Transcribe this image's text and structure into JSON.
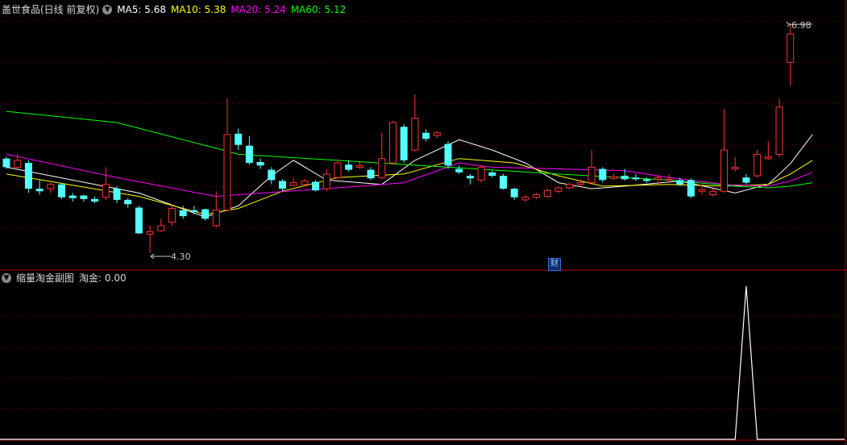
{
  "main_panel": {
    "title": "盖世食品(日线 前复权)",
    "ma": [
      {
        "label": "MA5: 5.68",
        "color": "#ffffff"
      },
      {
        "label": "MA10: 5.38",
        "color": "#ffff00"
      },
      {
        "label": "MA20: 5.24",
        "color": "#ff00ff"
      },
      {
        "label": "MA60: 5.12",
        "color": "#00ff00"
      }
    ],
    "high_label": "6.98",
    "low_label": "4.30",
    "event_marker": "财"
  },
  "sub_panel": {
    "title": "缩量淘金副图",
    "value_label": "淘金: 0.00"
  },
  "colors": {
    "up": "#ff3232",
    "down": "#54ffff",
    "grid": "#8b0000",
    "divider": "#b00000"
  },
  "chart_data": [
    {
      "type": "candlestick",
      "candles": [
        {
          "o": 5.4,
          "c": 5.3,
          "h": 5.42,
          "l": 5.28
        },
        {
          "o": 5.3,
          "c": 5.38,
          "h": 5.45,
          "l": 5.28
        },
        {
          "o": 5.35,
          "c": 5.05,
          "h": 5.38,
          "l": 5.0
        },
        {
          "o": 5.05,
          "c": 5.02,
          "h": 5.15,
          "l": 4.98
        },
        {
          "o": 5.05,
          "c": 5.1,
          "h": 5.12,
          "l": 5.0
        },
        {
          "o": 5.1,
          "c": 4.95,
          "h": 5.12,
          "l": 4.93
        },
        {
          "o": 4.97,
          "c": 4.94,
          "h": 5.0,
          "l": 4.9
        },
        {
          "o": 4.97,
          "c": 4.93,
          "h": 4.98,
          "l": 4.9
        },
        {
          "o": 4.93,
          "c": 4.9,
          "h": 4.96,
          "l": 4.88
        },
        {
          "o": 4.95,
          "c": 5.1,
          "h": 5.3,
          "l": 4.92
        },
        {
          "o": 5.05,
          "c": 4.92,
          "h": 5.08,
          "l": 4.88
        },
        {
          "o": 4.92,
          "c": 4.87,
          "h": 4.94,
          "l": 4.83
        },
        {
          "o": 4.83,
          "c": 4.53,
          "h": 4.85,
          "l": 4.52
        },
        {
          "o": 4.52,
          "c": 4.55,
          "h": 4.62,
          "l": 4.3
        },
        {
          "o": 4.56,
          "c": 4.62,
          "h": 4.7,
          "l": 4.55
        },
        {
          "o": 4.66,
          "c": 4.82,
          "h": 4.86,
          "l": 4.62
        },
        {
          "o": 4.8,
          "c": 4.73,
          "h": 4.85,
          "l": 4.7
        },
        {
          "o": 4.8,
          "c": 4.78,
          "h": 4.85,
          "l": 4.75
        },
        {
          "o": 4.81,
          "c": 4.7,
          "h": 4.82,
          "l": 4.68
        },
        {
          "o": 4.62,
          "c": 4.8,
          "h": 5.02,
          "l": 4.6
        },
        {
          "o": 4.8,
          "c": 5.68,
          "h": 6.1,
          "l": 4.8
        },
        {
          "o": 5.69,
          "c": 5.56,
          "h": 5.75,
          "l": 5.5
        },
        {
          "o": 5.55,
          "c": 5.35,
          "h": 5.66,
          "l": 5.33
        },
        {
          "o": 5.36,
          "c": 5.32,
          "h": 5.4,
          "l": 5.28
        },
        {
          "o": 5.27,
          "c": 5.15,
          "h": 5.3,
          "l": 5.1
        },
        {
          "o": 5.14,
          "c": 5.05,
          "h": 5.16,
          "l": 5.02
        },
        {
          "o": 5.09,
          "c": 5.12,
          "h": 5.18,
          "l": 5.08
        },
        {
          "o": 5.1,
          "c": 5.14,
          "h": 5.16,
          "l": 5.08
        },
        {
          "o": 5.13,
          "c": 5.03,
          "h": 5.15,
          "l": 5.02
        },
        {
          "o": 5.05,
          "c": 5.22,
          "h": 5.28,
          "l": 5.02
        },
        {
          "o": 5.18,
          "c": 5.35,
          "h": 5.37,
          "l": 5.16
        },
        {
          "o": 5.33,
          "c": 5.27,
          "h": 5.38,
          "l": 5.25
        },
        {
          "o": 5.3,
          "c": 5.32,
          "h": 5.36,
          "l": 5.28
        },
        {
          "o": 5.27,
          "c": 5.17,
          "h": 5.3,
          "l": 5.15
        },
        {
          "o": 5.18,
          "c": 5.4,
          "h": 5.7,
          "l": 5.16
        },
        {
          "o": 5.35,
          "c": 5.82,
          "h": 5.84,
          "l": 5.33
        },
        {
          "o": 5.77,
          "c": 5.38,
          "h": 5.8,
          "l": 5.35
        },
        {
          "o": 5.5,
          "c": 5.87,
          "h": 6.15,
          "l": 5.48
        },
        {
          "o": 5.7,
          "c": 5.63,
          "h": 5.74,
          "l": 5.6
        },
        {
          "o": 5.67,
          "c": 5.7,
          "h": 5.72,
          "l": 5.64
        },
        {
          "o": 5.57,
          "c": 5.32,
          "h": 5.6,
          "l": 5.28
        },
        {
          "o": 5.28,
          "c": 5.24,
          "h": 5.32,
          "l": 5.22
        },
        {
          "o": 5.2,
          "c": 5.17,
          "h": 5.22,
          "l": 5.1
        },
        {
          "o": 5.15,
          "c": 5.3,
          "h": 5.32,
          "l": 5.12
        },
        {
          "o": 5.24,
          "c": 5.2,
          "h": 5.26,
          "l": 5.18
        },
        {
          "o": 5.2,
          "c": 5.05,
          "h": 5.22,
          "l": 5.04
        },
        {
          "o": 5.05,
          "c": 4.95,
          "h": 5.06,
          "l": 4.92
        },
        {
          "o": 4.92,
          "c": 4.95,
          "h": 4.98,
          "l": 4.9
        },
        {
          "o": 4.95,
          "c": 4.98,
          "h": 5.0,
          "l": 4.93
        },
        {
          "o": 4.96,
          "c": 5.03,
          "h": 5.05,
          "l": 4.94
        },
        {
          "o": 5.02,
          "c": 5.06,
          "h": 5.08,
          "l": 5.0
        },
        {
          "o": 5.06,
          "c": 5.1,
          "h": 5.12,
          "l": 5.04
        },
        {
          "o": 5.1,
          "c": 5.12,
          "h": 5.16,
          "l": 5.08
        },
        {
          "o": 5.12,
          "c": 5.3,
          "h": 5.5,
          "l": 5.1
        },
        {
          "o": 5.28,
          "c": 5.15,
          "h": 5.3,
          "l": 5.12
        },
        {
          "o": 5.17,
          "c": 5.19,
          "h": 5.22,
          "l": 5.15
        },
        {
          "o": 5.2,
          "c": 5.16,
          "h": 5.28,
          "l": 5.14
        },
        {
          "o": 5.18,
          "c": 5.16,
          "h": 5.22,
          "l": 5.14
        },
        {
          "o": 5.16,
          "c": 5.14,
          "h": 5.18,
          "l": 5.12
        },
        {
          "o": 5.16,
          "c": 5.18,
          "h": 5.2,
          "l": 5.1
        },
        {
          "o": 5.15,
          "c": 5.16,
          "h": 5.22,
          "l": 5.14
        },
        {
          "o": 5.15,
          "c": 5.1,
          "h": 5.18,
          "l": 5.08
        },
        {
          "o": 5.15,
          "c": 4.96,
          "h": 5.17,
          "l": 4.94
        },
        {
          "o": 5.02,
          "c": 5.04,
          "h": 5.1,
          "l": 4.98
        },
        {
          "o": 4.98,
          "c": 5.02,
          "h": 5.05,
          "l": 4.96
        },
        {
          "o": 5.02,
          "c": 5.5,
          "h": 5.98,
          "l": 5.0
        },
        {
          "o": 5.28,
          "c": 5.3,
          "h": 5.42,
          "l": 5.25
        },
        {
          "o": 5.18,
          "c": 5.12,
          "h": 5.22,
          "l": 5.1
        },
        {
          "o": 5.2,
          "c": 5.45,
          "h": 5.5,
          "l": 5.18
        },
        {
          "o": 5.4,
          "c": 5.42,
          "h": 5.6,
          "l": 5.38
        },
        {
          "o": 5.45,
          "c": 6.0,
          "h": 6.1,
          "l": 5.42
        },
        {
          "o": 6.52,
          "c": 6.85,
          "h": 6.98,
          "l": 6.25
        }
      ],
      "ma": {
        "MA5": [
          [
            0,
            5.3
          ],
          [
            12,
            5.0
          ],
          [
            18,
            4.72
          ],
          [
            21,
            4.85
          ],
          [
            24,
            5.2
          ],
          [
            26,
            5.38
          ],
          [
            29,
            5.15
          ],
          [
            34,
            5.1
          ],
          [
            37,
            5.38
          ],
          [
            41,
            5.62
          ],
          [
            44,
            5.5
          ],
          [
            47,
            5.35
          ],
          [
            50,
            5.12
          ],
          [
            53,
            5.05
          ],
          [
            56,
            5.08
          ],
          [
            61,
            5.14
          ],
          [
            66,
            5.0
          ],
          [
            69,
            5.1
          ],
          [
            71,
            5.34
          ],
          [
            73,
            5.68
          ]
        ],
        "MA10": [
          [
            0,
            5.22
          ],
          [
            12,
            4.96
          ],
          [
            18,
            4.75
          ],
          [
            21,
            4.82
          ],
          [
            25,
            5.02
          ],
          [
            30,
            5.18
          ],
          [
            36,
            5.22
          ],
          [
            41,
            5.4
          ],
          [
            46,
            5.35
          ],
          [
            50,
            5.2
          ],
          [
            54,
            5.08
          ],
          [
            60,
            5.1
          ],
          [
            65,
            5.08
          ],
          [
            69,
            5.1
          ],
          [
            71,
            5.22
          ],
          [
            73,
            5.38
          ]
        ],
        "MA20": [
          [
            0,
            5.45
          ],
          [
            10,
            5.18
          ],
          [
            19,
            4.96
          ],
          [
            21,
            4.98
          ],
          [
            30,
            5.06
          ],
          [
            36,
            5.12
          ],
          [
            41,
            5.35
          ],
          [
            44,
            5.3
          ],
          [
            50,
            5.28
          ],
          [
            56,
            5.26
          ],
          [
            60,
            5.18
          ],
          [
            65,
            5.1
          ],
          [
            69,
            5.08
          ],
          [
            71,
            5.14
          ],
          [
            73,
            5.24
          ]
        ],
        "MA60": [
          [
            0,
            5.95
          ],
          [
            10,
            5.82
          ],
          [
            19,
            5.52
          ],
          [
            21,
            5.45
          ],
          [
            30,
            5.38
          ],
          [
            40,
            5.3
          ],
          [
            50,
            5.22
          ],
          [
            60,
            5.15
          ],
          [
            66,
            5.08
          ],
          [
            69,
            5.06
          ],
          [
            71,
            5.08
          ],
          [
            73,
            5.12
          ]
        ]
      }
    },
    {
      "type": "line",
      "name": "淘金",
      "values": [
        0,
        0,
        0,
        0,
        0,
        0,
        0,
        0,
        0,
        0,
        0,
        0,
        0,
        0,
        0,
        0,
        0,
        0,
        0,
        0,
        0,
        0,
        0,
        0,
        0,
        0,
        0,
        0,
        0,
        0,
        0,
        0,
        0,
        0,
        0,
        0,
        0,
        0,
        0,
        0,
        0,
        0,
        0,
        0,
        0,
        0,
        0,
        0,
        0,
        0,
        0,
        0,
        0,
        0,
        0,
        0,
        0,
        0,
        0,
        0,
        0,
        0,
        0,
        0,
        0,
        0,
        0,
        1,
        0,
        0,
        0,
        0,
        0,
        0
      ],
      "ylim": [
        0,
        1
      ]
    }
  ]
}
